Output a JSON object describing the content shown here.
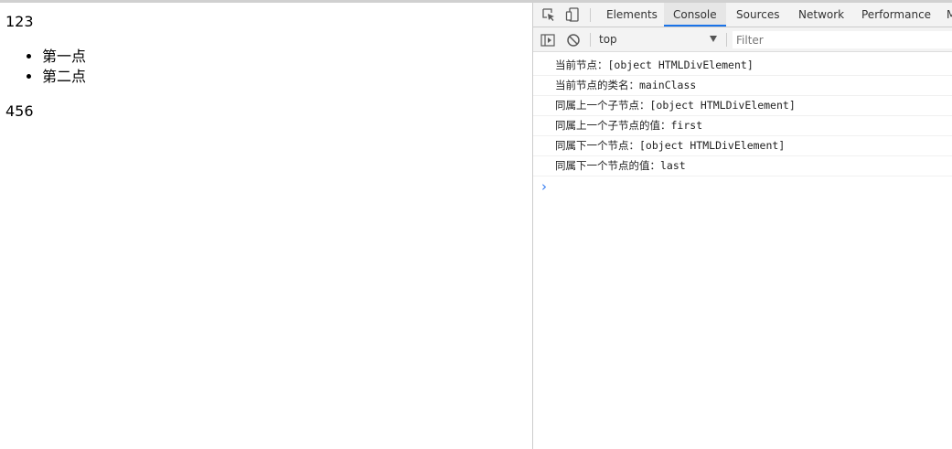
{
  "page": {
    "paragraph_first": "123",
    "list_items": [
      "第一点",
      "第二点"
    ],
    "paragraph_second": "456"
  },
  "devtools": {
    "tools": {
      "inspect_icon": "inspect-element-icon",
      "device_icon": "device-toolbar-icon"
    },
    "tabs": [
      {
        "label": "Elements",
        "active": false
      },
      {
        "label": "Console",
        "active": true
      },
      {
        "label": "Sources",
        "active": false
      },
      {
        "label": "Network",
        "active": false
      },
      {
        "label": "Performance",
        "active": false
      },
      {
        "label": "M",
        "active": false
      }
    ],
    "toolbar": {
      "sidebar_icon": "show-sidebar-icon",
      "clear_icon": "clear-console-icon",
      "context": "top",
      "filter_placeholder": "Filter"
    },
    "console_messages": [
      "当前节点：[object HTMLDivElement]",
      "当前节点的类名：mainClass",
      "同属上一个子节点：[object HTMLDivElement]",
      "同属上一个子节点的值：first",
      "同属下一个节点：[object HTMLDivElement]",
      "同属下一个节点的值：last"
    ],
    "prompt_symbol": "›"
  },
  "colors": {
    "accent": "#1a73e8",
    "prompt": "#367cf1",
    "toolbar_bg": "#f3f3f3"
  }
}
